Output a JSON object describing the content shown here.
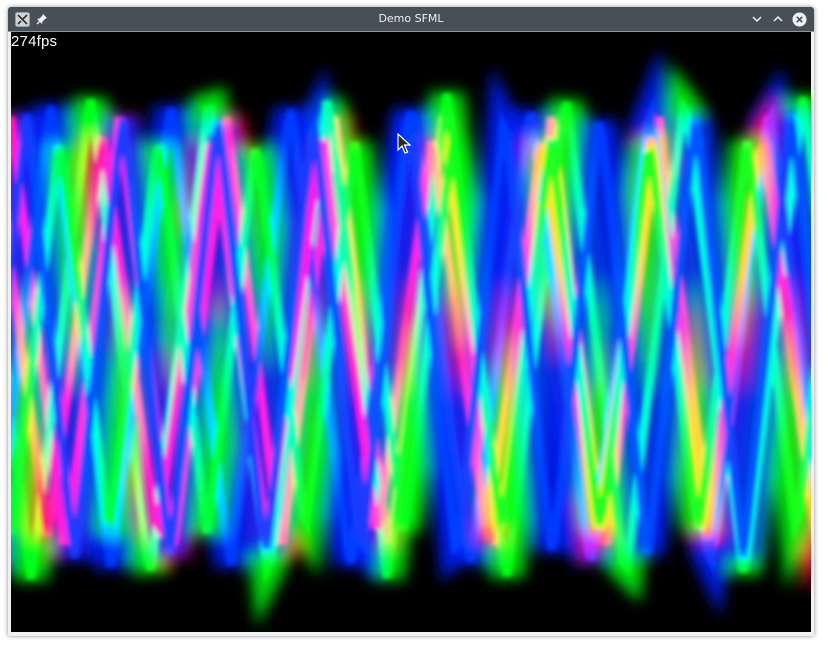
{
  "window": {
    "title": "Demo SFML",
    "buttons": {
      "app_icon": "x-app-icon",
      "pin": "pin-icon",
      "minimize": "chevron-down-icon",
      "maximize": "chevron-up-icon",
      "close": "close-icon"
    },
    "colors": {
      "titlebar": "#475057",
      "title_text": "#eff0f1",
      "focus_line": "#3daee9",
      "canvas_bg": "#000000"
    }
  },
  "canvas": {
    "fps_text": "274fps"
  }
}
